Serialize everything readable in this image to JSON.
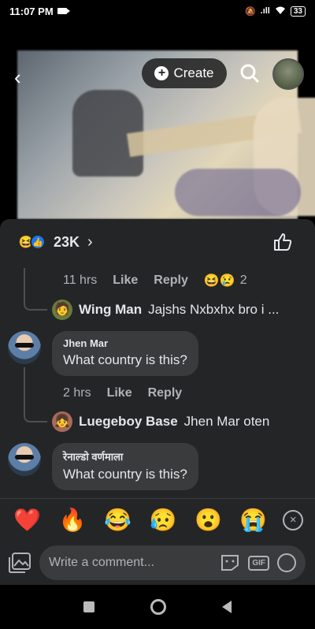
{
  "status_bar": {
    "time": "11:07 PM",
    "signal": ".ıll",
    "battery": "33"
  },
  "header": {
    "back_glyph": "‹",
    "create_label": "Create",
    "create_glyph": "+"
  },
  "reactions": {
    "emoji_laugh": "😆",
    "like_glyph": "👍",
    "count": "23K",
    "chevron": "›"
  },
  "thread1": {
    "time": "11 hrs",
    "like_label": "Like",
    "reply_label": "Reply",
    "react_1": "😆",
    "react_2": "😢",
    "react_count": "2",
    "reply_avatar": "🧑",
    "reply_name": "Wing Man",
    "reply_text": "Jajshs Nxbxhx bro i ..."
  },
  "comment1": {
    "name": "Jhen Mar",
    "text": "What country is this?"
  },
  "thread2": {
    "time": "2 hrs",
    "like_label": "Like",
    "reply_label": "Reply",
    "reply_avatar": "👧",
    "reply_name": "Luegeboy Base",
    "reply_text": "Jhen Mar oten"
  },
  "comment2": {
    "name": "रेनाल्डो वर्णमाला",
    "text": "What country is this?"
  },
  "emoji_bar": {
    "heart": "❤️",
    "fire": "🔥",
    "laugh": "😂",
    "sad": "😥",
    "wow": "😮",
    "cry": "😭",
    "close": "×"
  },
  "composer": {
    "placeholder": "Write a comment...",
    "gif_label": "GIF"
  },
  "colors": {
    "sheet_bg": "#242526",
    "bubble_bg": "#3a3b3c",
    "text": "#e4e6eb",
    "muted": "#b0b3b8",
    "like_blue": "#1877f2"
  }
}
